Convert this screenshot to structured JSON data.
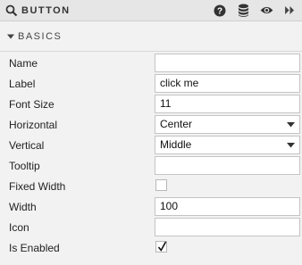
{
  "header": {
    "title": "BUTTON",
    "search_icon": "search-icon",
    "tools": [
      {
        "name": "help-icon"
      },
      {
        "name": "database-icon"
      },
      {
        "name": "eye-icon"
      },
      {
        "name": "fast-forward-icon"
      }
    ]
  },
  "section": {
    "label": "BASICS",
    "caret_icon": "caret-down-icon"
  },
  "rows": [
    {
      "label": "Name",
      "type": "text",
      "value": ""
    },
    {
      "label": "Label",
      "type": "text",
      "value": "click me"
    },
    {
      "label": "Font Size",
      "type": "text",
      "value": "11"
    },
    {
      "label": "Horizontal",
      "type": "select",
      "value": "Center"
    },
    {
      "label": "Vertical",
      "type": "select",
      "value": "Middle"
    },
    {
      "label": "Tooltip",
      "type": "text",
      "value": ""
    },
    {
      "label": "Fixed Width",
      "type": "checkbox",
      "checked": false
    },
    {
      "label": "Width",
      "type": "text",
      "value": "100"
    },
    {
      "label": "Icon",
      "type": "text",
      "value": ""
    },
    {
      "label": "Is Enabled",
      "type": "checkbox",
      "checked": true
    }
  ],
  "colors": {
    "header_bg": "#e6e6e6",
    "panel_bg": "#f2f2f2",
    "field_border": "#c4c4c4"
  }
}
